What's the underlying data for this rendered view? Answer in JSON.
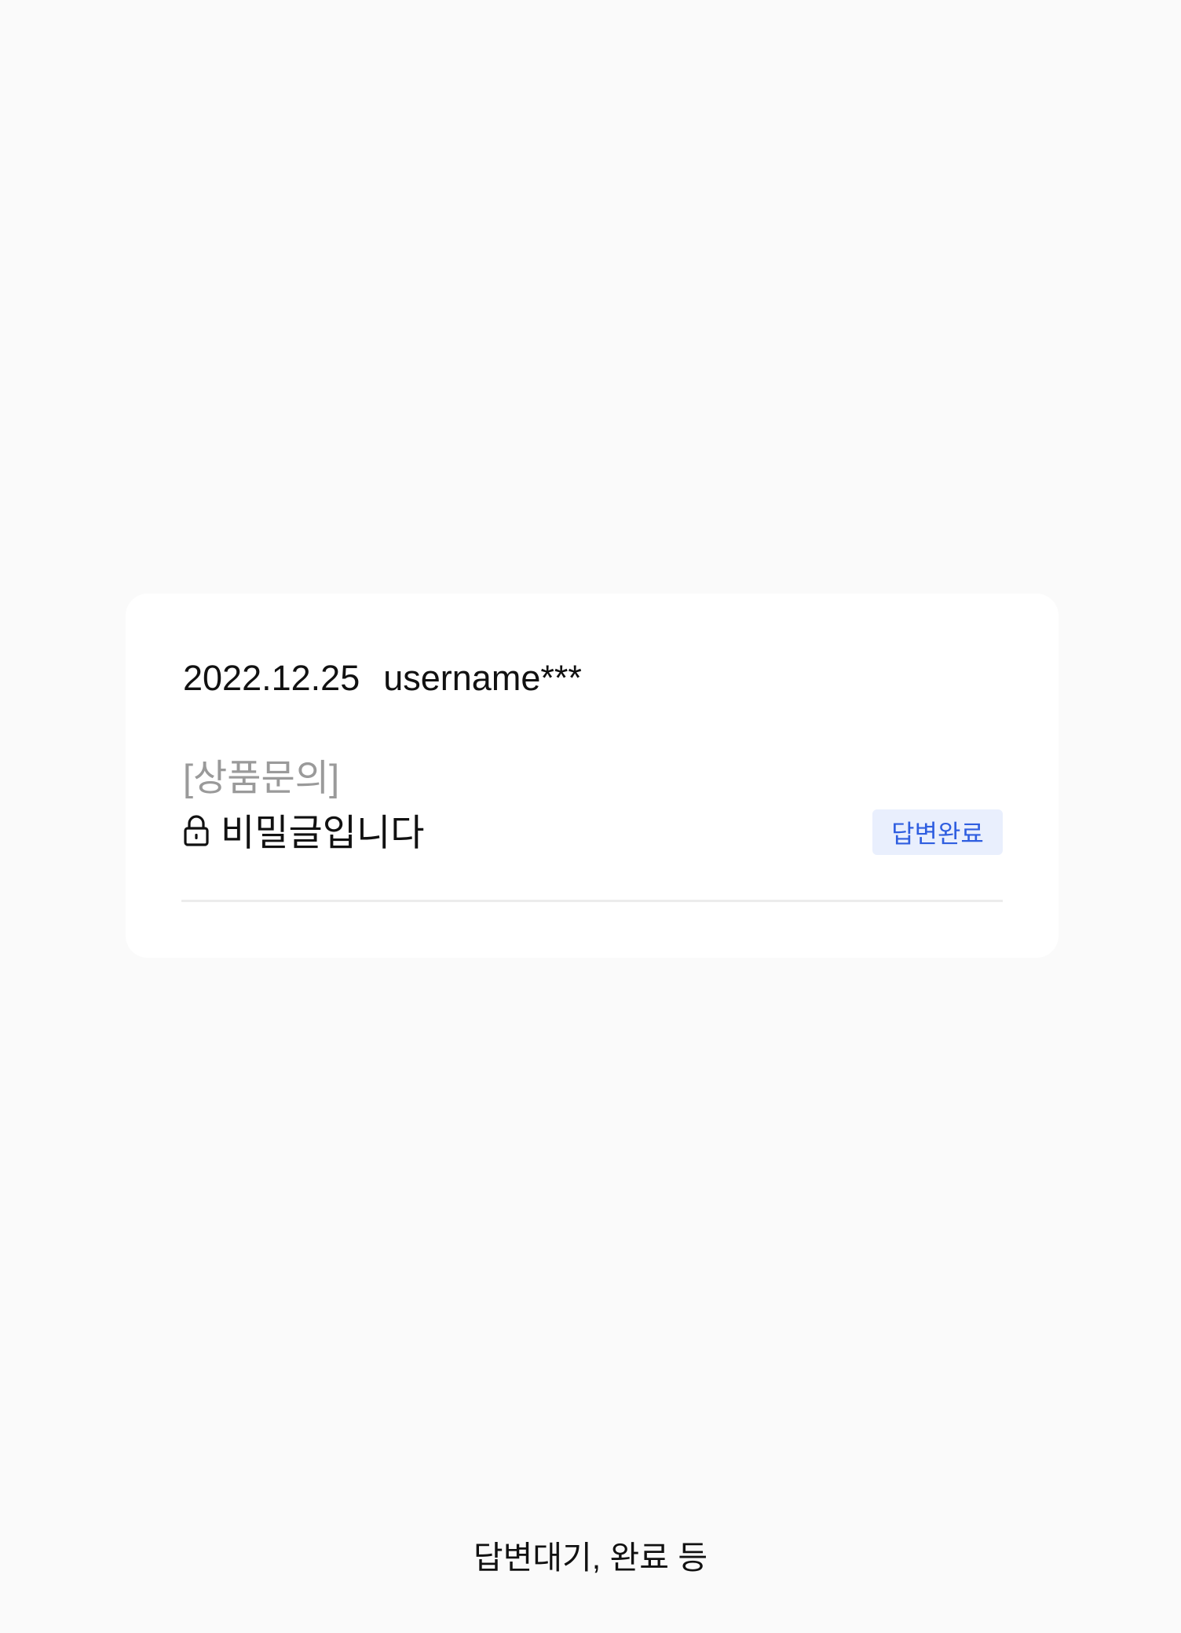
{
  "inquiry": {
    "date": "2022.12.25",
    "username": "username***",
    "category": "[상품문의]",
    "title": "비밀글입니다",
    "lock_icon": "lock-icon",
    "status": "답변완료"
  },
  "caption": "답변대기, 완료 등",
  "colors": {
    "page_background": "#fafafa",
    "card_background": "#ffffff",
    "category_text": "#9a9a9a",
    "badge_background": "#e9effd",
    "badge_text": "#2f5ee0",
    "divider": "#ececec"
  }
}
